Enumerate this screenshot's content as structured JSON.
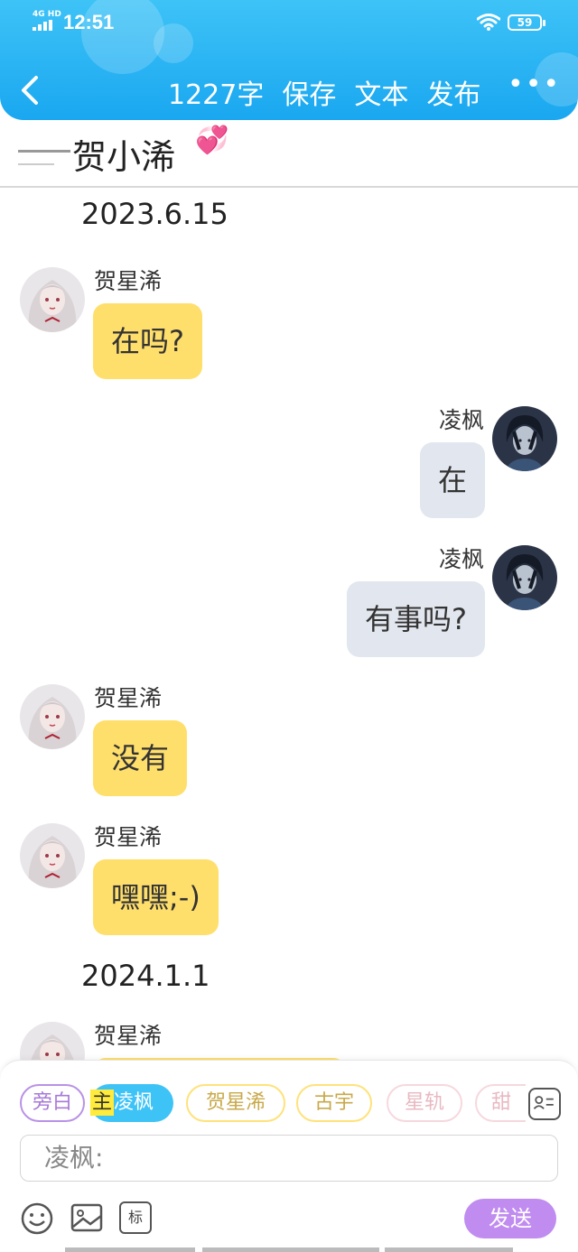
{
  "status_bar": {
    "network": "4G HD",
    "time": "12:51",
    "battery": "59"
  },
  "toolbar": {
    "word_count": "1227字",
    "save": "保存",
    "text": "文本",
    "publish": "发布",
    "more": "•••"
  },
  "title": "贺小浠",
  "messages": [
    {
      "type": "date",
      "text": "2023.6.15"
    },
    {
      "type": "msg",
      "side": "left",
      "name": "贺星浠",
      "text": "在吗?"
    },
    {
      "type": "msg",
      "side": "right",
      "name": "凌枫",
      "text": "在"
    },
    {
      "type": "msg",
      "side": "right",
      "name": "凌枫",
      "text": "有事吗?"
    },
    {
      "type": "msg",
      "side": "left",
      "name": "贺星浠",
      "text": "没有"
    },
    {
      "type": "msg",
      "side": "left",
      "name": "贺星浠",
      "text": "嘿嘿;-)"
    },
    {
      "type": "date",
      "text": "2024.1.1"
    },
    {
      "type": "msg",
      "side": "left",
      "name": "贺星浠",
      "text": ""
    }
  ],
  "roles": {
    "narration": "旁白",
    "main_tag": "主",
    "main": "凌枫",
    "r1": "贺星浠",
    "r2": "古宇",
    "r3": "星轨",
    "r4": "甜"
  },
  "input": {
    "placeholder": "凌枫:"
  },
  "tools": {
    "tag_label": "标"
  },
  "send": "发送",
  "colors": {
    "header": "#1fa9f1",
    "left_bubble": "#ffdf6b",
    "right_bubble": "#e2e6ee",
    "send": "#c08cf0"
  }
}
